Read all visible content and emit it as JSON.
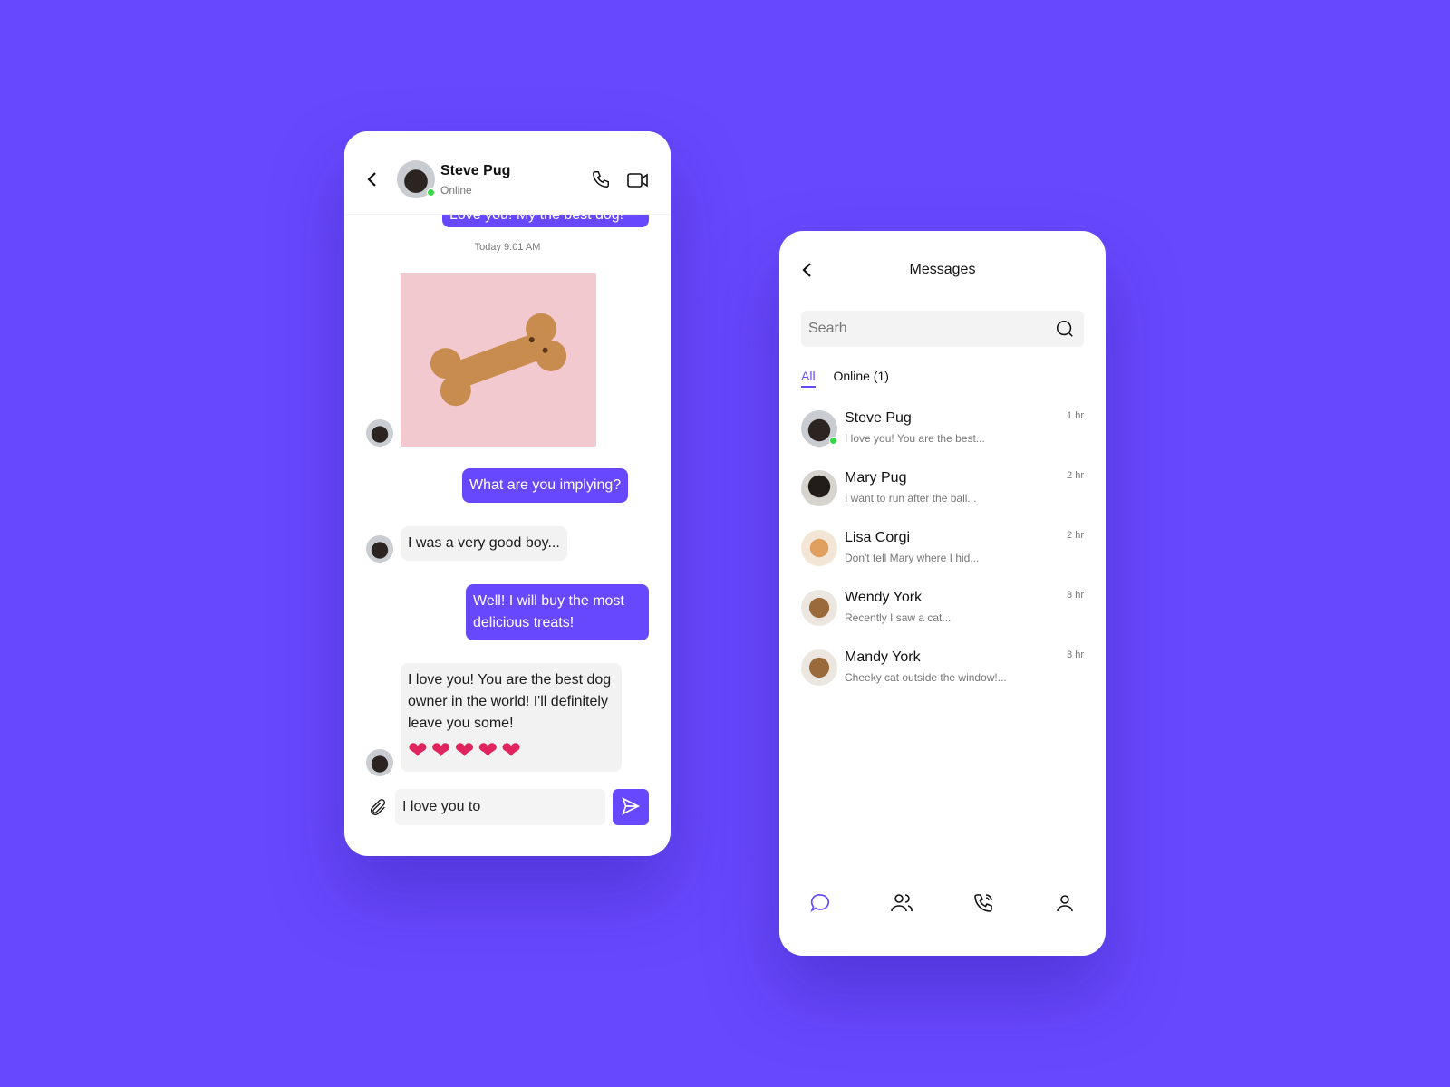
{
  "chat": {
    "contact_name": "Steve Pug",
    "contact_status": "Online",
    "cutoff_message": "Love you! My the best dog!",
    "timestamp": "Today 9:01 AM",
    "messages": [
      {
        "from": "me",
        "text": "What are you implying?"
      },
      {
        "from": "them",
        "text": "I was a very good boy..."
      },
      {
        "from": "me",
        "text": "Well! I will buy the most delicious treats!"
      },
      {
        "from": "them",
        "text": "I love you! You are the best dog owner in the world! I'll definitely leave you some!"
      }
    ],
    "hearts": "❤❤❤❤❤",
    "composer_value": "I love you to"
  },
  "list": {
    "title": "Messages",
    "search_placeholder": "Searh",
    "tabs": [
      {
        "label": "All",
        "active": true
      },
      {
        "label": "Online (1)",
        "active": false
      }
    ],
    "contacts": [
      {
        "name": "Steve Pug",
        "preview": "I love you! You are the best...",
        "time": "1 hr",
        "online": true
      },
      {
        "name": "Mary Pug",
        "preview": "I want to run after the ball...",
        "time": "2 hr"
      },
      {
        "name": "Lisa Corgi",
        "preview": "Don't tell Mary where I hid...",
        "time": "2 hr"
      },
      {
        "name": "Wendy York",
        "preview": "Recently I saw a cat...",
        "time": "3 hr"
      },
      {
        "name": "Mandy York",
        "preview": "Cheeky cat outside the window!...",
        "time": "3 hr"
      }
    ],
    "nav": [
      "chat-icon",
      "contacts-icon",
      "calls-icon",
      "profile-icon"
    ]
  },
  "colors": {
    "accent": "#6848fd",
    "online": "#3ad64a",
    "background": "#6848fd"
  }
}
